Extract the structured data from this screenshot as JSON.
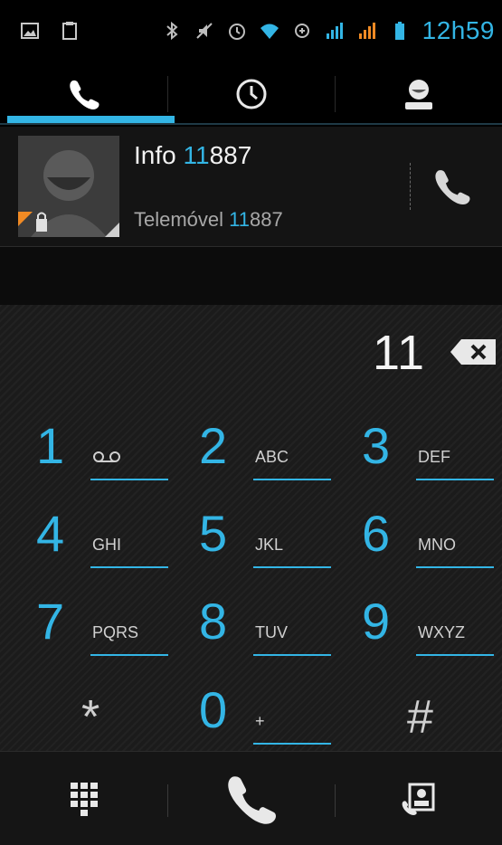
{
  "status_bar": {
    "icons_left": [
      "image-icon",
      "clipboard-icon"
    ],
    "icons_right": [
      "bluetooth-icon",
      "mute-icon",
      "alarm-icon",
      "wifi-icon",
      "data-icon",
      "signal-icon",
      "signal-icon",
      "battery-icon"
    ],
    "time": "12h59",
    "accent": "#33b5e5"
  },
  "tabs": [
    {
      "name": "phone-tab",
      "icon": "phone-icon",
      "selected": true
    },
    {
      "name": "recents-tab",
      "icon": "clock-icon",
      "selected": false
    },
    {
      "name": "contacts-tab",
      "icon": "person-icon",
      "selected": false
    }
  ],
  "contact": {
    "name_prefix": "Info ",
    "name_highlight": "11",
    "name_rest": "887",
    "type": "Telemóvel ",
    "number_highlight": "11",
    "number_rest": "887"
  },
  "dial": {
    "entered": "11"
  },
  "keys": [
    {
      "num": "1",
      "letters": "voicemail"
    },
    {
      "num": "2",
      "letters": "ABC"
    },
    {
      "num": "3",
      "letters": "DEF"
    },
    {
      "num": "4",
      "letters": "GHI"
    },
    {
      "num": "5",
      "letters": "JKL"
    },
    {
      "num": "6",
      "letters": "MNO"
    },
    {
      "num": "7",
      "letters": "PQRS"
    },
    {
      "num": "8",
      "letters": "TUV"
    },
    {
      "num": "9",
      "letters": "WXYZ"
    },
    {
      "num": "*"
    },
    {
      "num": "0",
      "letters": "+"
    },
    {
      "num": "#"
    }
  ],
  "action_bar": [
    "dialpad-icon",
    "call-icon",
    "contact-card-icon"
  ]
}
